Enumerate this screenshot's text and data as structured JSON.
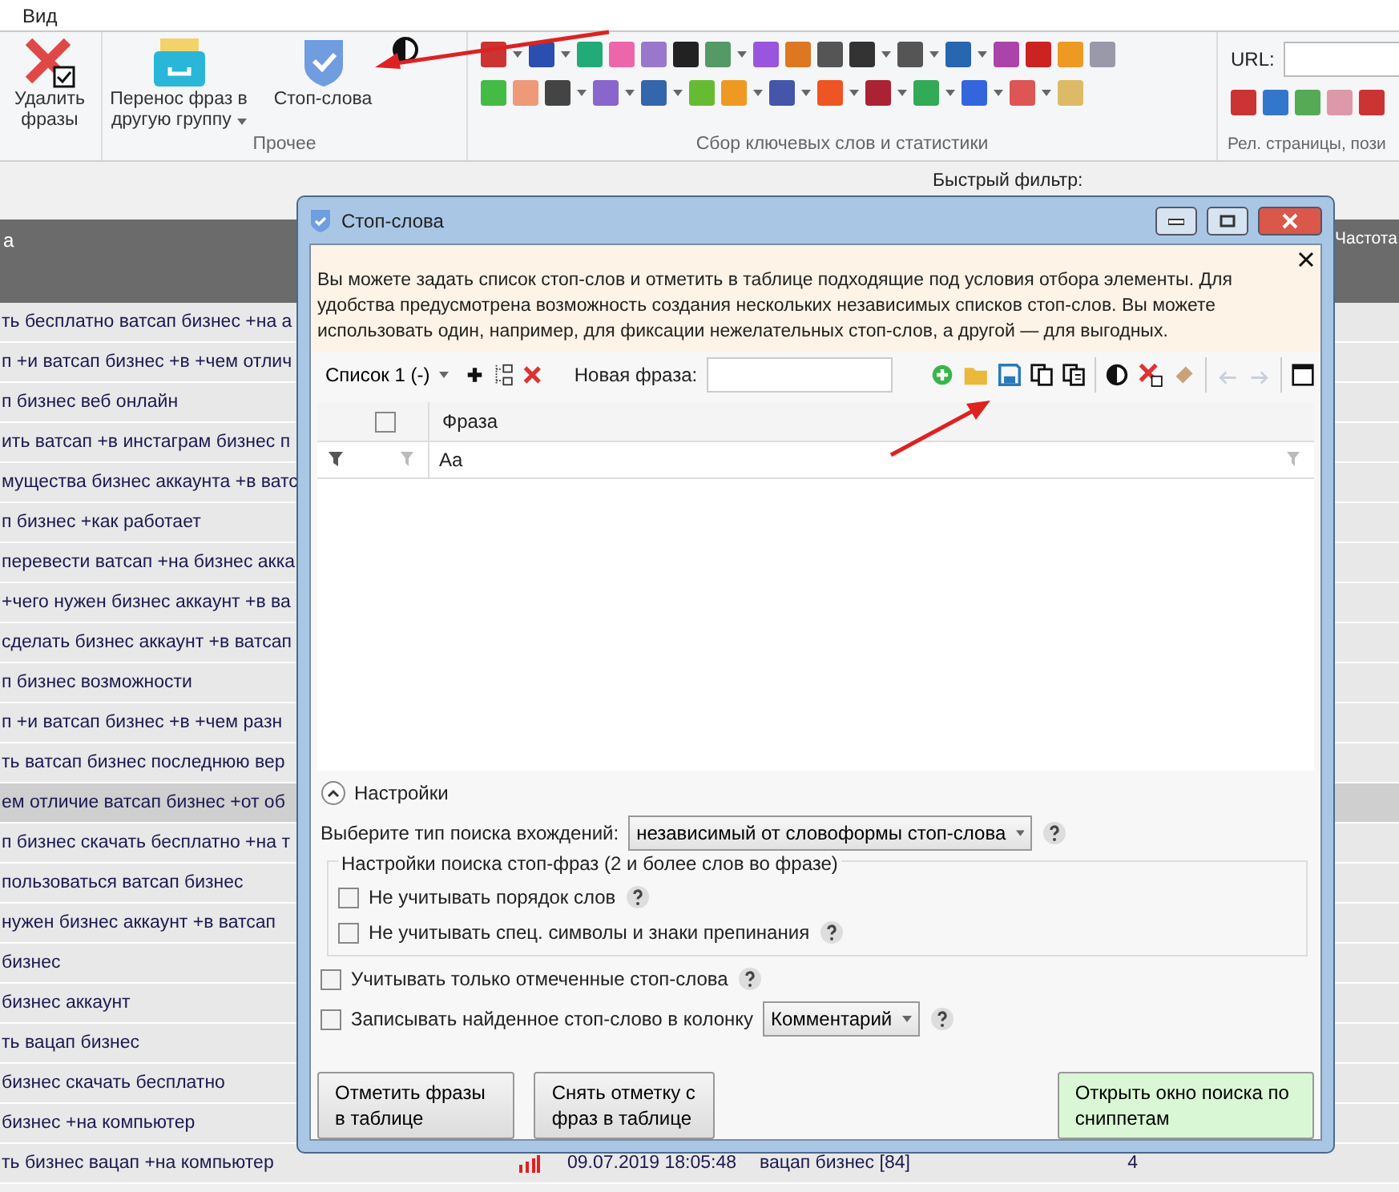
{
  "menu": [
    {
      "label": "Вид"
    }
  ],
  "ribbon": {
    "buttons": [
      {
        "kind": "delete",
        "label": "Удалить фразы",
        "dropdown": false
      },
      {
        "kind": "move",
        "label": "Перенос фраз в другую группу",
        "dropdown": true
      },
      {
        "kind": "stop",
        "label": "Стоп-слова",
        "dropdown": false
      }
    ],
    "group_labels": [
      "Прочее",
      "Сбор ключевых слов и статистики",
      "Рел. страницы, пози"
    ],
    "url_label": "URL:"
  },
  "quick_filter_label": "Быстрый фильтр:",
  "table": {
    "columns": [
      "а",
      "Частота"
    ],
    "rows": [
      {
        "phrase": "ть бесплатно ватсап бизнес +на а",
        "selected": false
      },
      {
        "phrase": "п +и ватсап бизнес +в +чем отлич",
        "selected": false
      },
      {
        "phrase": "п бизнес веб онлайн",
        "selected": false
      },
      {
        "phrase": "ить ватсап +в инстаграм бизнес п",
        "selected": false
      },
      {
        "phrase": "мущества бизнес аккаунта +в ватс",
        "selected": false
      },
      {
        "phrase": "п бизнес +как работает",
        "selected": false
      },
      {
        "phrase": "перевести ватсап +на бизнес акка",
        "selected": false
      },
      {
        "phrase": "+чего нужен бизнес аккаунт +в ва",
        "selected": false
      },
      {
        "phrase": "сделать бизнес аккаунт +в ватсап",
        "selected": false
      },
      {
        "phrase": "п бизнес возможности",
        "selected": false
      },
      {
        "phrase": "п +и ватсап бизнес +в +чем разн",
        "selected": false
      },
      {
        "phrase": "ть ватсап бизнес последнюю вер",
        "selected": false
      },
      {
        "phrase": "ем отличие ватсап бизнес +от об",
        "selected": true
      },
      {
        "phrase": "п бизнес скачать бесплатно +на т",
        "selected": false
      },
      {
        "phrase": "пользоваться ватсап бизнес",
        "selected": false
      },
      {
        "phrase": "нужен бизнес аккаунт +в ватсап",
        "selected": false
      },
      {
        "phrase": "бизнес",
        "selected": false
      },
      {
        "phrase": "бизнес аккаунт",
        "selected": false
      },
      {
        "phrase": "ть вацап бизнес",
        "selected": false
      },
      {
        "phrase": "бизнес скачать бесплатно",
        "selected": false
      },
      {
        "phrase": "бизнес +на компьютер",
        "selected": false
      },
      {
        "phrase": "ть бизнес вацап +на компьютер",
        "selected": false,
        "date": "09.07.2019 18:05:48",
        "group": "вацап бизнес [84]",
        "count": "4"
      }
    ]
  },
  "dialog": {
    "title": "Стоп-слова",
    "info": "Вы можете задать список стоп-слов и отметить в таблице подходящие под условия отбора элементы. Для удобства предусмотрена возможность создания нескольких независимых списков стоп-слов. Вы можете использовать один, например, для фиксации нежелательных стоп-слов, а другой — для выгодных.",
    "list_select": "Список 1 (-)",
    "new_phrase_label": "Новая фраза:",
    "history_buttons": [
      {
        "kind": "undo",
        "disabled": true
      },
      {
        "kind": "redo",
        "disabled": true
      }
    ],
    "grid": {
      "header_checked": false,
      "column": "Фраза",
      "filter_text": "Aa"
    },
    "settings": {
      "label": "Настройки",
      "expanded": true,
      "search_type_label": "Выберите тип поиска вхождений:",
      "search_type_value": "независимый от словоформы стоп-слова",
      "group_title": "Настройки поиска стоп-фраз (2 и более слов во фразе)",
      "group_options": [
        {
          "label": "Не учитывать порядок слов",
          "checked": false
        },
        {
          "label": "Не учитывать спец. символы и знаки препинания",
          "checked": false
        }
      ],
      "options": [
        {
          "label": "Учитывать только отмеченные стоп-слова",
          "checked": false
        },
        {
          "label": "Записывать найденное стоп-слово в колонку",
          "checked": false,
          "column_select": "Комментарий"
        }
      ]
    },
    "buttons": [
      {
        "label": "Отметить фразы в таблице",
        "kind": "plain"
      },
      {
        "label": "Снять отметку с фраз в таблице",
        "kind": "plain"
      },
      {
        "label": "Открыть окно поиска по сниппетам",
        "kind": "accent"
      }
    ]
  }
}
